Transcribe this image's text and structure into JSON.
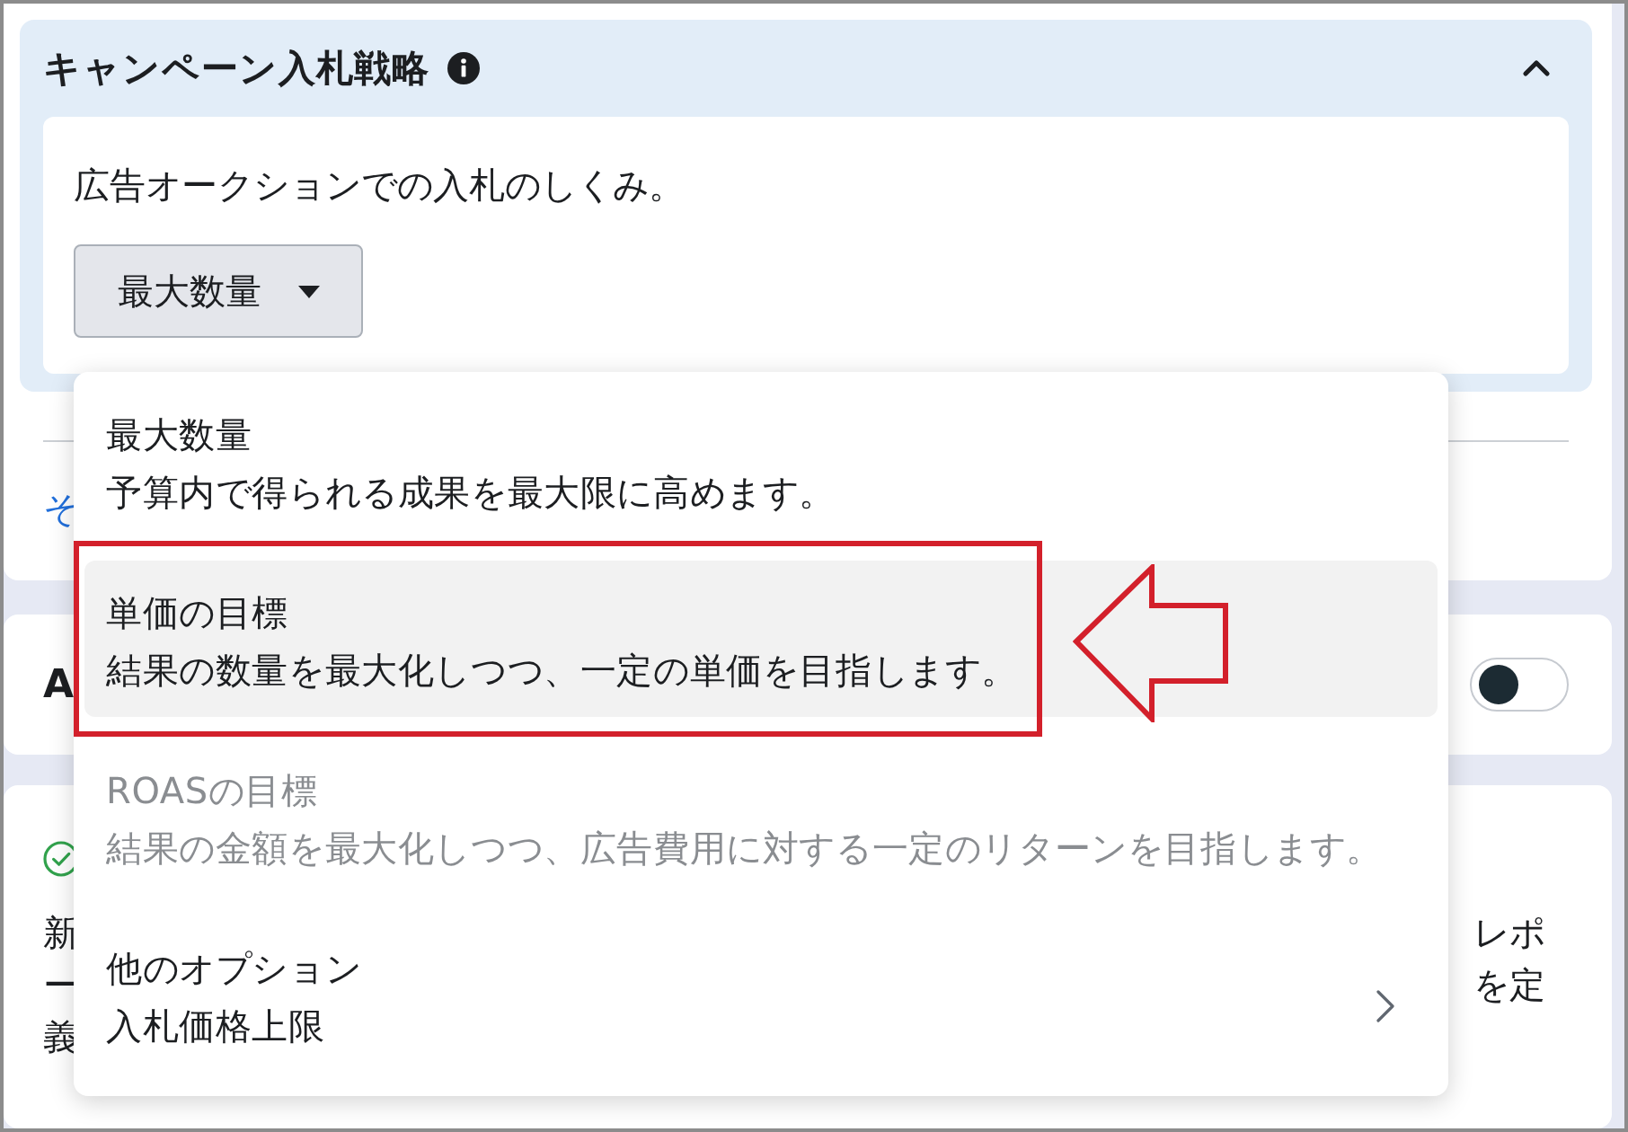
{
  "panel": {
    "title": "キャンペーン入札戦略",
    "expanded": true,
    "description": "広告オークションでの入札のしくみ。",
    "dropdown": {
      "value": "最大数量",
      "open": true
    }
  },
  "link_fragment": "そ",
  "section_a": {
    "title_fragment": "A",
    "toggle_on": false
  },
  "section_c": {
    "lines": [
      {
        "left": "新",
        "right": "レポ"
      },
      {
        "left": "ー",
        "right": "を定"
      },
      {
        "left": "義"
      }
    ]
  },
  "menu": {
    "items": [
      {
        "kind": "option",
        "title": "最大数量",
        "description": "予算内で得られる成果を最大限に高めます。",
        "selected": false,
        "disabled": false
      },
      {
        "kind": "option",
        "title": "単価の目標",
        "description": "結果の数量を最大化しつつ、一定の単価を目指します。",
        "selected": true,
        "disabled": false
      },
      {
        "kind": "option",
        "title": "ROASの目標",
        "description": "結果の金額を最大化しつつ、広告費用に対する一定のリターンを目指します。",
        "selected": false,
        "disabled": true
      },
      {
        "kind": "submenu",
        "title": "他のオプション",
        "description": "入札価格上限",
        "selected": false,
        "disabled": false
      }
    ]
  }
}
